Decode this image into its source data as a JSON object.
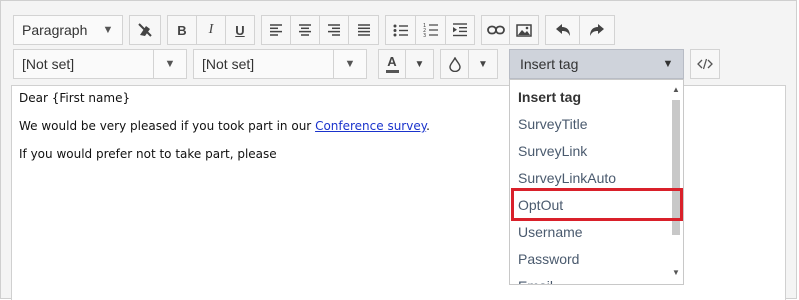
{
  "toolbar": {
    "format_select": {
      "value": "Paragraph"
    },
    "buttons_row1": {
      "clear_format": "clear-format-icon",
      "bold": "B",
      "italic": "I",
      "underline": "U",
      "align_left": "align-left-icon",
      "align_center": "align-center-icon",
      "align_right": "align-right-icon",
      "align_justify": "align-justify-icon",
      "bullet_list": "bullet-list-icon",
      "numbered_list": "numbered-list-icon",
      "indent": "indent-icon",
      "link": "link-icon",
      "image": "image-icon",
      "undo": "undo-icon",
      "redo": "redo-icon"
    },
    "font_family_select": {
      "value": "[Not set]"
    },
    "font_size_select": {
      "value": "[Not set]"
    },
    "text_color_label": "A",
    "insert_tag_select": {
      "value": "Insert tag"
    },
    "source_code_icon": "code-icon"
  },
  "content": {
    "line1": "Dear {First name}",
    "line2_before": "We would be very pleased if you took part in our ",
    "line2_link": "Conference survey",
    "line2_after": ".",
    "line3": "If you would prefer not to take part, please"
  },
  "dropdown": {
    "header": "Insert tag",
    "items": [
      "SurveyTitle",
      "SurveyLink",
      "SurveyLinkAuto",
      "OptOut",
      "Username",
      "Password",
      "Email"
    ],
    "highlighted": "OptOut"
  },
  "colors": {
    "highlight_border": "#d9202a",
    "link": "#1a33cc",
    "tag_select_bg": "#cfd3db"
  }
}
